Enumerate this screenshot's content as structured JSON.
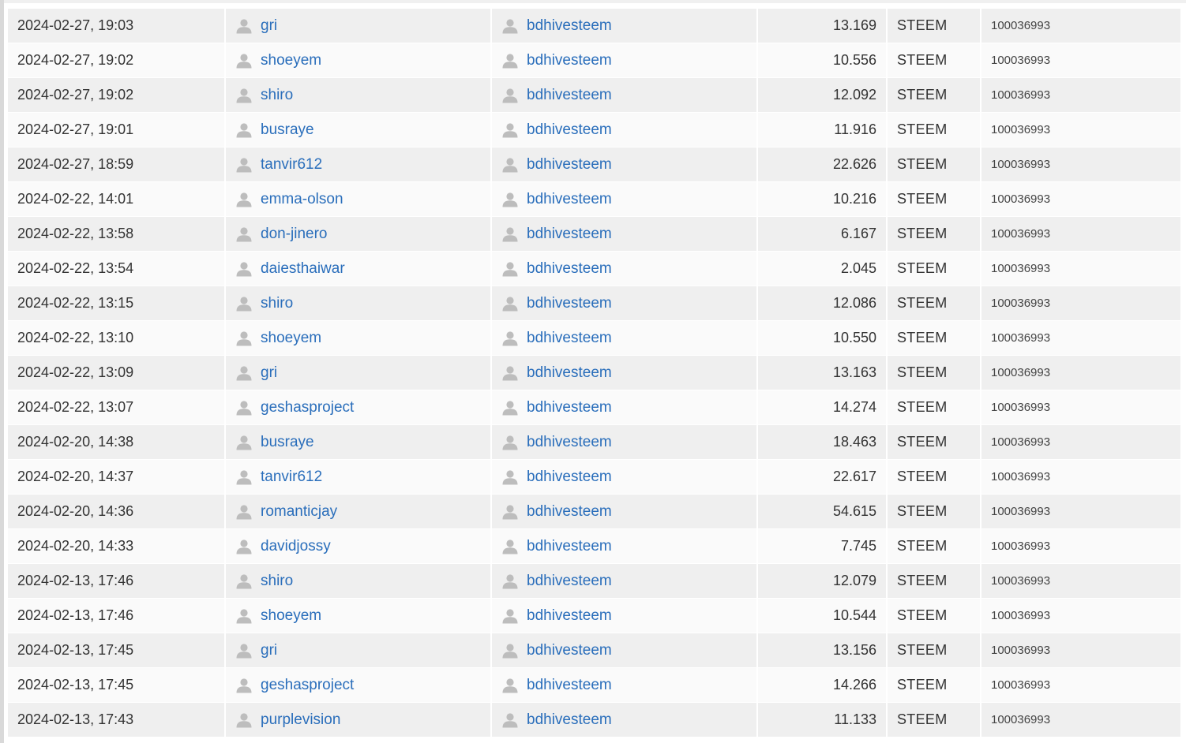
{
  "table": {
    "icon": "user-icon",
    "colors": {
      "link": "#2a6ebb",
      "row_odd": "#efefef",
      "row_even": "#fafafa",
      "icon": "#bdbdbd"
    },
    "rows": [
      {
        "date": "2024-02-27, 19:03",
        "from": "gri",
        "to": "bdhivesteem",
        "amount": "13.169",
        "asset": "STEEM",
        "memo": "100036993"
      },
      {
        "date": "2024-02-27, 19:02",
        "from": "shoeyem",
        "to": "bdhivesteem",
        "amount": "10.556",
        "asset": "STEEM",
        "memo": "100036993"
      },
      {
        "date": "2024-02-27, 19:02",
        "from": "shiro",
        "to": "bdhivesteem",
        "amount": "12.092",
        "asset": "STEEM",
        "memo": "100036993"
      },
      {
        "date": "2024-02-27, 19:01",
        "from": "busraye",
        "to": "bdhivesteem",
        "amount": "11.916",
        "asset": "STEEM",
        "memo": "100036993"
      },
      {
        "date": "2024-02-27, 18:59",
        "from": "tanvir612",
        "to": "bdhivesteem",
        "amount": "22.626",
        "asset": "STEEM",
        "memo": "100036993"
      },
      {
        "date": "2024-02-22, 14:01",
        "from": "emma-olson",
        "to": "bdhivesteem",
        "amount": "10.216",
        "asset": "STEEM",
        "memo": "100036993"
      },
      {
        "date": "2024-02-22, 13:58",
        "from": "don-jinero",
        "to": "bdhivesteem",
        "amount": "6.167",
        "asset": "STEEM",
        "memo": "100036993"
      },
      {
        "date": "2024-02-22, 13:54",
        "from": "daiesthaiwar",
        "to": "bdhivesteem",
        "amount": "2.045",
        "asset": "STEEM",
        "memo": "100036993"
      },
      {
        "date": "2024-02-22, 13:15",
        "from": "shiro",
        "to": "bdhivesteem",
        "amount": "12.086",
        "asset": "STEEM",
        "memo": "100036993"
      },
      {
        "date": "2024-02-22, 13:10",
        "from": "shoeyem",
        "to": "bdhivesteem",
        "amount": "10.550",
        "asset": "STEEM",
        "memo": "100036993"
      },
      {
        "date": "2024-02-22, 13:09",
        "from": "gri",
        "to": "bdhivesteem",
        "amount": "13.163",
        "asset": "STEEM",
        "memo": "100036993"
      },
      {
        "date": "2024-02-22, 13:07",
        "from": "geshasproject",
        "to": "bdhivesteem",
        "amount": "14.274",
        "asset": "STEEM",
        "memo": "100036993"
      },
      {
        "date": "2024-02-20, 14:38",
        "from": "busraye",
        "to": "bdhivesteem",
        "amount": "18.463",
        "asset": "STEEM",
        "memo": "100036993"
      },
      {
        "date": "2024-02-20, 14:37",
        "from": "tanvir612",
        "to": "bdhivesteem",
        "amount": "22.617",
        "asset": "STEEM",
        "memo": "100036993"
      },
      {
        "date": "2024-02-20, 14:36",
        "from": "romanticjay",
        "to": "bdhivesteem",
        "amount": "54.615",
        "asset": "STEEM",
        "memo": "100036993"
      },
      {
        "date": "2024-02-20, 14:33",
        "from": "davidjossy",
        "to": "bdhivesteem",
        "amount": "7.745",
        "asset": "STEEM",
        "memo": "100036993"
      },
      {
        "date": "2024-02-13, 17:46",
        "from": "shiro",
        "to": "bdhivesteem",
        "amount": "12.079",
        "asset": "STEEM",
        "memo": "100036993"
      },
      {
        "date": "2024-02-13, 17:46",
        "from": "shoeyem",
        "to": "bdhivesteem",
        "amount": "10.544",
        "asset": "STEEM",
        "memo": "100036993"
      },
      {
        "date": "2024-02-13, 17:45",
        "from": "gri",
        "to": "bdhivesteem",
        "amount": "13.156",
        "asset": "STEEM",
        "memo": "100036993"
      },
      {
        "date": "2024-02-13, 17:45",
        "from": "geshasproject",
        "to": "bdhivesteem",
        "amount": "14.266",
        "asset": "STEEM",
        "memo": "100036993"
      },
      {
        "date": "2024-02-13, 17:43",
        "from": "purplevision",
        "to": "bdhivesteem",
        "amount": "11.133",
        "asset": "STEEM",
        "memo": "100036993"
      }
    ]
  }
}
